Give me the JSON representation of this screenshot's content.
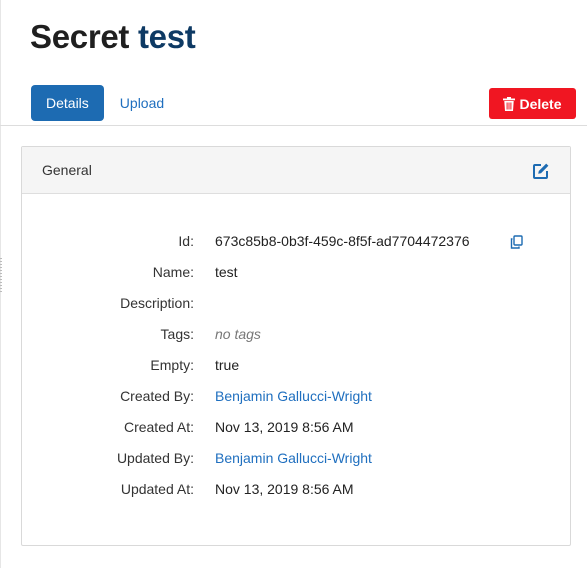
{
  "header": {
    "title_prefix": "Secret",
    "title_name": "test"
  },
  "tabs": [
    {
      "label": "Details",
      "active": true
    },
    {
      "label": "Upload",
      "active": false
    }
  ],
  "actions": {
    "delete_label": "Delete",
    "delete_icon": "trash-icon"
  },
  "panel": {
    "title": "General",
    "edit_icon": "edit-icon",
    "fields": {
      "id": {
        "label": "Id:",
        "value": "673c85b8-0b3f-459c-8f5f-ad7704472376",
        "copy_icon": "copy-icon"
      },
      "name": {
        "label": "Name:",
        "value": "test"
      },
      "description": {
        "label": "Description:",
        "value": ""
      },
      "tags": {
        "label": "Tags:",
        "value": "no tags"
      },
      "empty": {
        "label": "Empty:",
        "value": "true"
      },
      "created_by": {
        "label": "Created By:",
        "value": "Benjamin Gallucci-Wright"
      },
      "created_at": {
        "label": "Created At:",
        "value": "Nov 13, 2019 8:56 AM"
      },
      "updated_by": {
        "label": "Updated By:",
        "value": "Benjamin Gallucci-Wright"
      },
      "updated_at": {
        "label": "Updated At:",
        "value": "Nov 13, 2019 8:56 AM"
      }
    }
  },
  "colors": {
    "primary": "#1d6bb2",
    "link": "#1f6fbf",
    "danger": "#f01622",
    "title_name": "#0e3a64"
  }
}
